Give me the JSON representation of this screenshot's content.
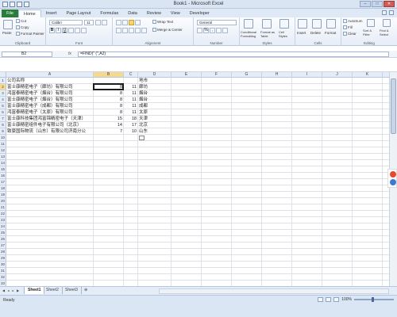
{
  "window": {
    "title": "Book1 - Microsoft Excel",
    "minimize_label": "–",
    "maximize_label": "□",
    "close_label": "✕"
  },
  "tabs": {
    "file": "File",
    "items": [
      "Home",
      "Insert",
      "Page Layout",
      "Formulas",
      "Data",
      "Review",
      "View",
      "Developer"
    ],
    "active": "Home"
  },
  "ribbon": {
    "clipboard": {
      "paste": "Paste",
      "cut": "Cut",
      "copy": "Copy",
      "format_painter": "Format Painter",
      "label": "Clipboard"
    },
    "font": {
      "font_name": "Calibri",
      "font_size": "11",
      "bold": "B",
      "italic": "I",
      "underline": "U",
      "label": "Font"
    },
    "alignment": {
      "wrap_text": "Wrap Text",
      "merge_center": "Merge & Center",
      "label": "Alignment"
    },
    "number": {
      "format": "General",
      "percent": "%",
      "comma": ",",
      "label": "Number"
    },
    "styles": {
      "conditional": "Conditional Formatting",
      "format_table": "Format as Table",
      "cell_styles": "Cell Styles",
      "label": "Styles"
    },
    "cells": {
      "insert": "Insert",
      "delete": "Delete",
      "format": "Format",
      "label": "Cells"
    },
    "editing": {
      "autosum": "AutoSum",
      "fill": "Fill",
      "clear": "Clear",
      "sort_filter": "Sort & Filter",
      "find_select": "Find & Select",
      "label": "Editing"
    }
  },
  "formula_bar": {
    "name_box": "B2",
    "fx": "fx",
    "formula": "=FIND(\" (\",A2)"
  },
  "grid": {
    "columns": [
      "A",
      "B",
      "C",
      "D",
      "E",
      "F",
      "G",
      "H",
      "I",
      "J",
      "K",
      "L"
    ],
    "rows": [
      "1",
      "2",
      "3",
      "4",
      "5",
      "6",
      "7",
      "8",
      "9",
      "10",
      "11",
      "12",
      "13",
      "14",
      "15",
      "16",
      "17",
      "18",
      "19",
      "20",
      "21",
      "22",
      "23",
      "24",
      "25",
      "26",
      "27",
      "28",
      "29",
      "30",
      "31",
      "32",
      "33"
    ],
    "selected_column": "B",
    "selected_row": "2",
    "a_values": [
      "公司名称",
      "富士康精密电子（廊坊）有限公司",
      "鸿富泰精密电子（烟台）有限公司",
      "富士康精密电子（烟台）有限公司",
      "富士康精密电子（成都）有限公司",
      "鸿富泰精密电子（太原）有限公司",
      "富士康科技集团鸿富锦精密电子（天津）",
      "富士康精密组件电子有限公司（北京）",
      "致豪国际物流（山东）有限公司济南分公"
    ],
    "b_values": [
      "",
      "8",
      "8",
      "8",
      "8",
      "8",
      "15",
      "14",
      "7"
    ],
    "c_values": [
      "",
      "11",
      "11",
      "11",
      "11",
      "11",
      "18",
      "17",
      "10"
    ],
    "d_values": [
      "地市",
      "廊坊",
      "烟台",
      "烟台",
      "成都",
      "太原",
      "天津",
      "北京",
      "山东"
    ]
  },
  "sheets": {
    "tabs": [
      "Sheet1",
      "Sheet2",
      "Sheet3"
    ],
    "active": "Sheet1"
  },
  "status": {
    "ready": "Ready",
    "zoom": "100%"
  },
  "icons": [
    "paste-icon",
    "cut-icon",
    "copy-icon",
    "format-painter-icon",
    "wrap-text-icon",
    "merge-icon",
    "conditional-format-icon",
    "format-table-icon",
    "cell-styles-icon",
    "insert-icon",
    "delete-icon",
    "format-icon",
    "autosum-icon",
    "fill-icon",
    "clear-icon",
    "sort-filter-icon",
    "find-select-icon",
    "paste-options-icon"
  ],
  "colors": {
    "file_tab": "#2a7d3b",
    "selection_header": "#f7d98b",
    "ribbon_bg": "#e6edf7"
  }
}
